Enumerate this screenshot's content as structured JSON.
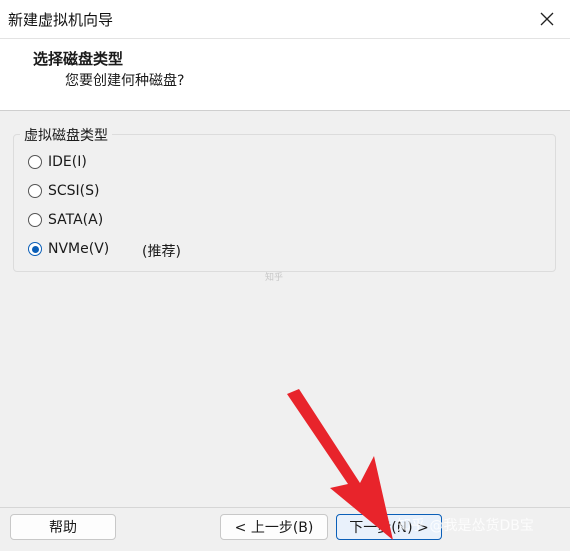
{
  "window": {
    "title": "新建虚拟机向导"
  },
  "header": {
    "title": "选择磁盘类型",
    "subtitle": "您要创建何种磁盘?"
  },
  "group": {
    "label": "虚拟磁盘类型",
    "options": [
      {
        "label": "IDE(I)",
        "checked": false
      },
      {
        "label": "SCSI(S)",
        "checked": false
      },
      {
        "label": "SATA(A)",
        "checked": false
      },
      {
        "label": "NVMe(V)",
        "checked": true
      }
    ],
    "recommend_label": "(推荐)"
  },
  "buttons": {
    "help": "帮助",
    "back": "< 上一步(B)",
    "next": "下一步(N) >"
  },
  "watermark": {
    "text": "知乎 @我是怂货DB宝",
    "small": "知乎"
  },
  "colors": {
    "accent": "#0b5fb8",
    "arrow": "#e8242b"
  }
}
